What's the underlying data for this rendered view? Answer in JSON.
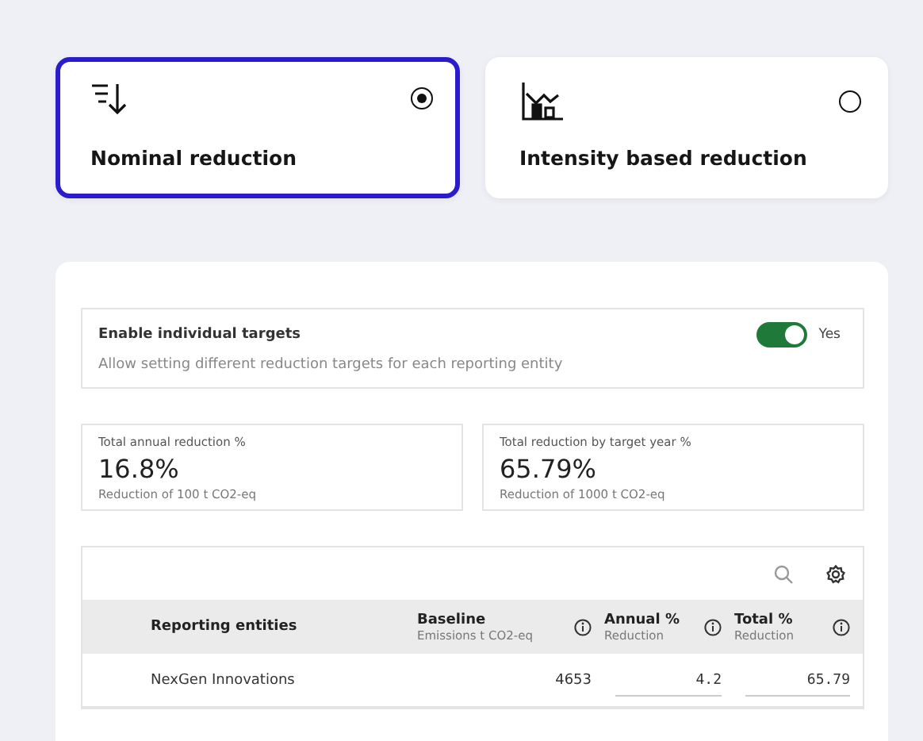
{
  "options": [
    {
      "kind": "nominal",
      "label": "Nominal reduction",
      "selected": true
    },
    {
      "kind": "intensity",
      "label": "Intensity based reduction",
      "selected": false
    }
  ],
  "individual_targets": {
    "title": "Enable individual targets",
    "description": "Allow setting different reduction targets for each reporting entity",
    "on": true,
    "state_label": "Yes"
  },
  "stats": [
    {
      "label": "Total annual reduction %",
      "value": "16.8%",
      "note": "Reduction of 100 t CO2-eq"
    },
    {
      "label": "Total reduction by target year %",
      "value": "65.79%",
      "note": "Reduction of 1000 t CO2-eq"
    }
  ],
  "table": {
    "columns": [
      {
        "title": "Reporting entities"
      },
      {
        "title": "Baseline",
        "subtitle": "Emissions t CO2-eq",
        "info": true
      },
      {
        "title": "Annual %",
        "subtitle": "Reduction",
        "info": true
      },
      {
        "title": "Total %",
        "subtitle": "Reduction",
        "info": true
      }
    ],
    "rows": [
      {
        "cells": [
          "NexGen Innovations",
          "4653",
          "4.2",
          "65.79"
        ]
      }
    ]
  }
}
